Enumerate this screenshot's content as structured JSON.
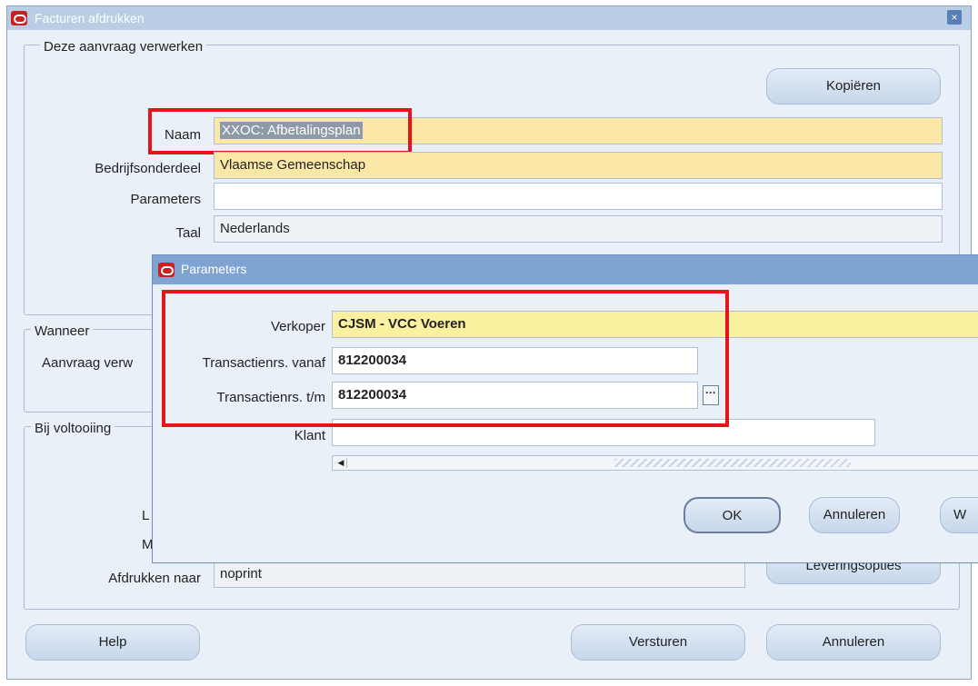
{
  "main_window": {
    "title": "Facturen afdrukken",
    "section_process": "Deze aanvraag verwerken",
    "copy_button": "Kopiëren",
    "name_label": "Naam",
    "name_value": "XXOC: Afbetalingsplan",
    "org_label": "Bedrijfsonderdeel",
    "org_value": "Vlaamse Gemeenschap",
    "params_label": "Parameters",
    "params_value": "",
    "lang_label": "Taal",
    "lang_value": "Nederlands",
    "section_when": "Wanneer",
    "when_label_partial": "Aanvraag verw",
    "section_completion": "Bij voltooiing",
    "completion_partial_1": "L",
    "completion_partial_2": "M",
    "print_to_label": "Afdrukken naar",
    "print_to_value": "noprint",
    "delivery_button_partial": "Leveringsopties",
    "help_button": "Help",
    "submit_button": "Versturen",
    "cancel_button": "Annuleren"
  },
  "params_dialog": {
    "title": "Parameters",
    "seller_label": "Verkoper",
    "seller_value": "CJSM - VCC Voeren",
    "trans_from_label": "Transactienrs. vanaf",
    "trans_from_value": "812200034",
    "trans_to_label": "Transactienrs. t/m",
    "trans_to_value": "812200034",
    "customer_label": "Klant",
    "customer_value": "",
    "ok_button": "OK",
    "cancel_button": "Annuleren",
    "third_button_partial": "W"
  },
  "colors": {
    "highlight_red": "#e3151b",
    "required_field": "#fbe8a6",
    "window_bg": "#eaf0f8"
  }
}
